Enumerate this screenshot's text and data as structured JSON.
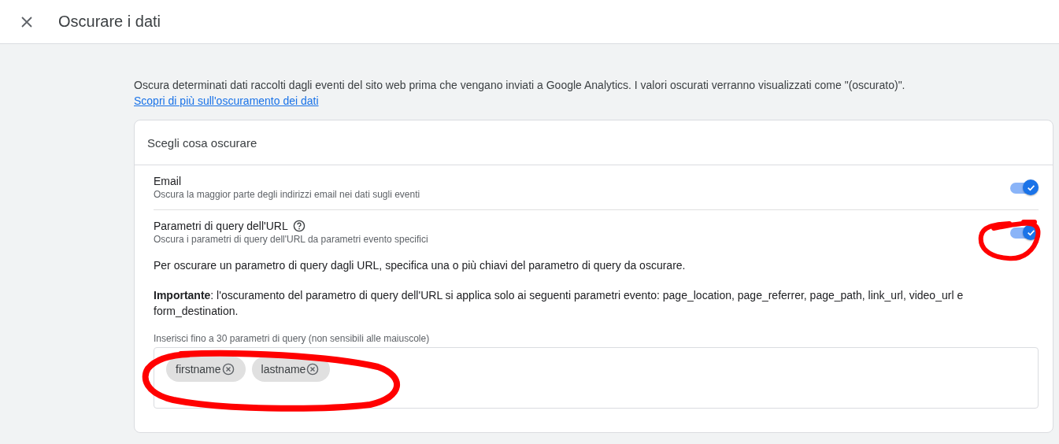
{
  "header": {
    "title": "Oscurare i dati"
  },
  "intro": {
    "text": "Oscura determinati dati raccolti dagli eventi del sito web prima che vengano inviati a Google Analytics. I valori oscurati verranno visualizzati come \"(oscurato)\".",
    "link": "Scopri di più sull'oscuramento dei dati"
  },
  "card": {
    "title": "Scegli cosa oscurare",
    "options": [
      {
        "title": "Email",
        "help": false,
        "description": "Oscura la maggior parte degli indirizzi email nei dati sugli eventi",
        "on": true
      },
      {
        "title": "Parametri di query dell'URL",
        "help": true,
        "description": "Oscura i parametri di query dell'URL da parametri evento specifici",
        "on": true
      }
    ],
    "instructions": "Per oscurare un parametro di query dagli URL, specifica una o più chiavi del parametro di query da oscurare.",
    "important": "**Importante**: l'oscuramento del parametro di query dell'URL si applica solo ai seguenti parametri evento: page_location, page_referrer, page_path, link_url, video_url e form_destination.",
    "field_label": "Inserisci fino a 30 parametri di query (non sensibili alle maiuscole)",
    "chips": [
      "firstname",
      "lastname"
    ]
  }
}
